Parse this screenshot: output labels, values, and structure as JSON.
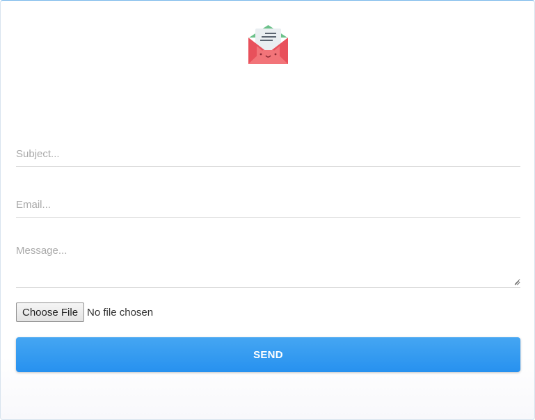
{
  "form": {
    "subject_placeholder": "Subject...",
    "email_placeholder": "Email...",
    "message_placeholder": "Message...",
    "file_button_label": "Choose File",
    "file_status": "No file chosen",
    "send_label": "SEND"
  },
  "icons": {
    "logo": "envelope-letter-icon",
    "resize": "resize-grip-icon"
  },
  "colors": {
    "accent": "#2f9af0",
    "envelope_red": "#e8505b",
    "envelope_green": "#6cc18a"
  }
}
